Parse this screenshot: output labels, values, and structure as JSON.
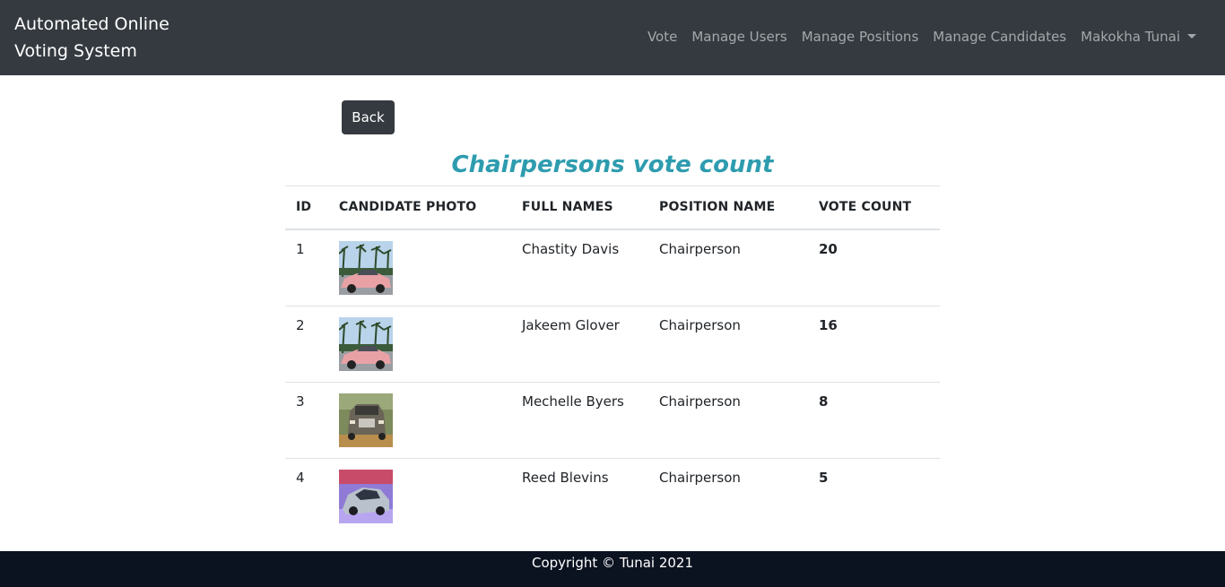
{
  "brand": "Automated Online Voting System",
  "nav": {
    "vote": "Vote",
    "manage_users": "Manage Users",
    "manage_positions": "Manage Positions",
    "manage_candidates": "Manage Candidates",
    "user_name": "Makokha Tunai"
  },
  "back_button": "Back",
  "title": "Chairpersons vote count",
  "table": {
    "headers": [
      "ID",
      "CANDIDATE PHOTO",
      "FULL NAMES",
      "POSITION NAME",
      "VOTE COUNT"
    ],
    "rows": [
      {
        "id": "1",
        "photo": "pink-sports-car-photo",
        "name": "Chastity Davis",
        "position": "Chairperson",
        "votes": "20"
      },
      {
        "id": "2",
        "photo": "pink-sports-car-photo",
        "name": "Jakeem Glover",
        "position": "Chairperson",
        "votes": "16"
      },
      {
        "id": "3",
        "photo": "luxury-sedan-photo",
        "name": "Mechelle Byers",
        "position": "Chairperson",
        "votes": "8"
      },
      {
        "id": "4",
        "photo": "silver-supercar-photo",
        "name": "Reed Blevins",
        "position": "Chairperson",
        "votes": "5"
      }
    ]
  },
  "footer": "Copyright © Tunai 2021",
  "colors": {
    "navbar": "#343a40",
    "title": "#2e9caf",
    "footer": "#0b1220"
  }
}
